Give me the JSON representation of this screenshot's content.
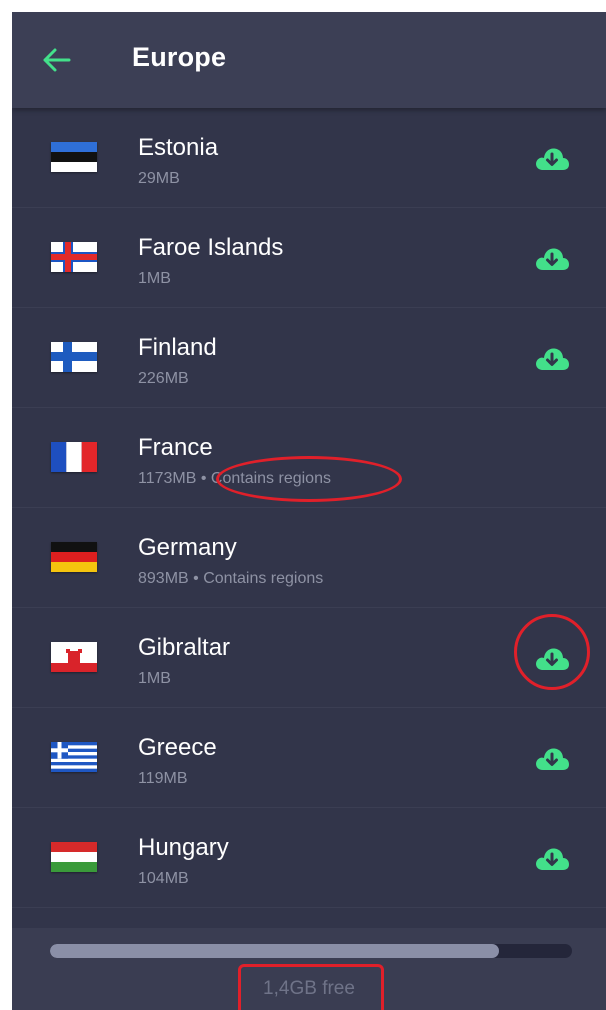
{
  "header": {
    "title": "Europe",
    "back_icon": "arrow-left-icon"
  },
  "colors": {
    "accent": "#43e08a",
    "annotation": "#e0202a"
  },
  "countries": [
    {
      "name": "Estonia",
      "size": "29MB",
      "suffix": "",
      "flag": "estonia",
      "download": true
    },
    {
      "name": "Faroe Islands",
      "size": "1MB",
      "suffix": "",
      "flag": "faroe",
      "download": true
    },
    {
      "name": "Finland",
      "size": "226MB",
      "suffix": "",
      "flag": "finland",
      "download": true
    },
    {
      "name": "France",
      "size": "1173MB",
      "suffix": " • Contains regions",
      "flag": "france",
      "download": false
    },
    {
      "name": "Germany",
      "size": "893MB",
      "suffix": " • Contains regions",
      "flag": "germany",
      "download": false
    },
    {
      "name": "Gibraltar",
      "size": "1MB",
      "suffix": "",
      "flag": "gibraltar",
      "download": true
    },
    {
      "name": "Greece",
      "size": "119MB",
      "suffix": "",
      "flag": "greece",
      "download": true
    },
    {
      "name": "Hungary",
      "size": "104MB",
      "suffix": "",
      "flag": "hungary",
      "download": true
    }
  ],
  "storage": {
    "used_fraction": 0.86,
    "free_label": "1,4GB free"
  }
}
